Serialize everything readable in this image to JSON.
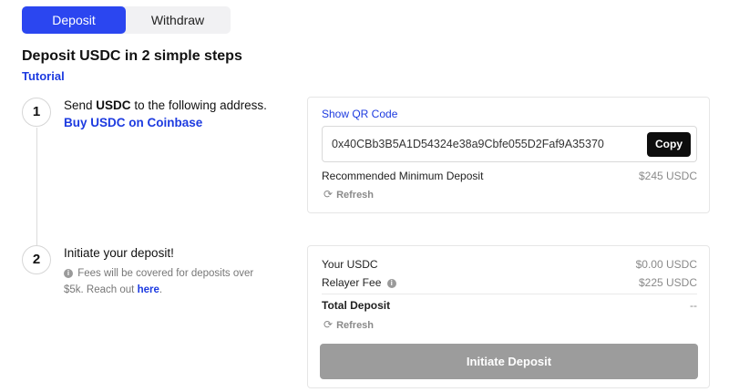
{
  "tabs": [
    {
      "label": "Deposit"
    },
    {
      "label": "Withdraw"
    }
  ],
  "title": "Deposit USDC in 2 simple steps",
  "tutorial_label": "Tutorial",
  "step1": {
    "number": "1",
    "text_prefix": "Send",
    "text_token": "USDC",
    "text_suffix": "to the following address.",
    "buy_link": "Buy USDC on Coinbase"
  },
  "step2": {
    "number": "2",
    "title": "Initiate your deposit!",
    "note": "Fees will be covered for deposits over $5k. Reach out",
    "note_link": "here",
    "note_end": "."
  },
  "card1": {
    "show_qr_label": "Show QR Code",
    "address": "0x40CBb3B5A1D54324e38a9Cbfe055D2Faf9A35370",
    "copy_label": "Copy",
    "min_deposit_label": "Recommended Minimum Deposit",
    "min_deposit_value": "$245 USDC",
    "refresh_label": "Refresh"
  },
  "card2": {
    "your_usdc_label": "Your USDC",
    "your_usdc_value": "$0.00 USDC",
    "relayer_fee_label": "Relayer Fee",
    "relayer_fee_value": "$225 USDC",
    "total_label": "Total Deposit",
    "total_value": "--",
    "refresh_label": "Refresh",
    "initiate_label": "Initiate Deposit"
  },
  "colors": {
    "accent": "#2b46f0",
    "link": "#1d3be0",
    "button_dark": "#0d0d0d",
    "button_disabled": "#9c9c9c"
  }
}
